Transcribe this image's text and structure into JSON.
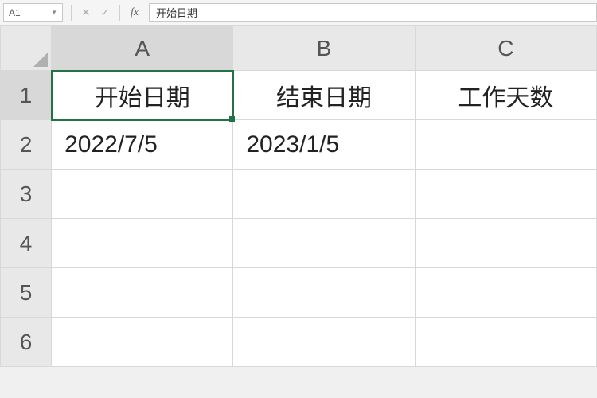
{
  "nameBox": {
    "value": "A1"
  },
  "formulaBar": {
    "value": "开始日期"
  },
  "columns": [
    "A",
    "B",
    "C"
  ],
  "rows": [
    "1",
    "2",
    "3",
    "4",
    "5",
    "6"
  ],
  "activeCell": "A1",
  "cells": {
    "A1": "开始日期",
    "B1": "结束日期",
    "C1": "工作天数",
    "A2": "2022/7/5",
    "B2": "2023/1/5"
  }
}
